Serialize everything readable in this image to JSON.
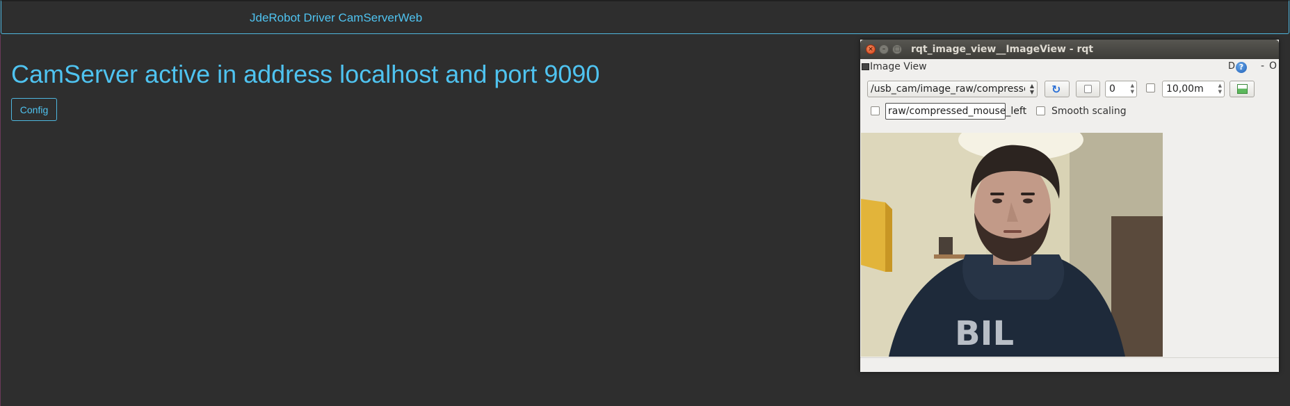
{
  "page": {
    "navbar_brand": "JdeRobot Driver CamServerWeb",
    "heading": "CamServer active in address localhost and port 9090",
    "config_button": "Config"
  },
  "rqt_window": {
    "title": "rqt_image_view__ImageView - rqt",
    "dock_title": "Image View",
    "dock_buttons": {
      "d": "D",
      "help": "?",
      "minimize": "-",
      "close": "O"
    },
    "topic_selected": "/usb_cam/image_raw/compressed",
    "spin_value": "0",
    "rate_value": "10,00m",
    "mouse_topic": "raw/compressed_mouse_left",
    "smooth_scaling_label": "Smooth scaling",
    "smooth_scaling_checked": false,
    "mouse_publish_checked": false,
    "rate_checked": false
  },
  "colors": {
    "background": "#2e2e2e",
    "accent": "#4fc3f0"
  },
  "icons": {
    "refresh": "refresh-icon",
    "pan": "pan-icon",
    "save": "save-icon",
    "help": "help-icon"
  }
}
